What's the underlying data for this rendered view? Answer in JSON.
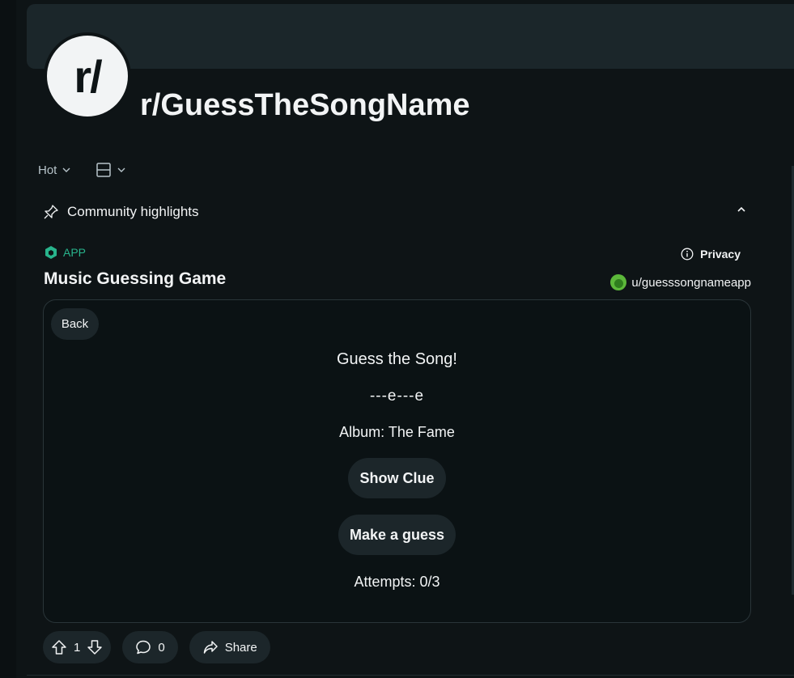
{
  "header": {
    "avatar_text": "r/",
    "subreddit_name": "r/GuessTheSongName"
  },
  "toolbar": {
    "sort_label": "Hot"
  },
  "highlights": {
    "label": "Community highlights"
  },
  "post": {
    "app_tag": "APP",
    "title": "Music Guessing Game",
    "privacy_label": "Privacy",
    "author": "u/guesssongnameapp"
  },
  "game": {
    "back_label": "Back",
    "heading": "Guess the Song!",
    "masked_word": "---e---e",
    "album": "Album: The Fame",
    "clue_button": "Show Clue",
    "guess_button": "Make a guess",
    "attempts": "Attempts: 0/3"
  },
  "actions": {
    "votes": "1",
    "comments": "0",
    "share_label": "Share"
  },
  "colors": {
    "background": "#0e1416",
    "accent_app": "#28b48c",
    "button_bg": "#1c262a"
  }
}
